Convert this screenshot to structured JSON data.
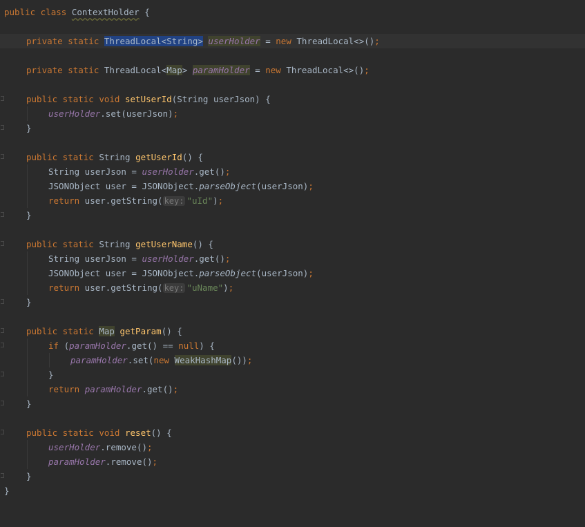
{
  "code": {
    "class_decl": {
      "kw": "public class",
      "name": "ContextHolder",
      "brace": "{"
    },
    "user_holder": {
      "mods": "private static",
      "type": "ThreadLocal<String>",
      "name": "userHolder",
      "assign": "=",
      "kw_new": "new",
      "init": "ThreadLocal<>()",
      "semi": ";"
    },
    "param_holder": {
      "mods": "private static",
      "type_a": "ThreadLocal<",
      "type_b": "Map",
      "type_c": ">",
      "name": "paramHolder",
      "assign": "=",
      "kw_new": "new",
      "init": "ThreadLocal<>()",
      "semi": ";"
    },
    "set_user": {
      "mods": "public static void",
      "name": "setUserId",
      "params": "(String userJson) {",
      "body_field": "userHolder",
      "body_call": ".set(userJson)",
      "semi": ";",
      "close": "}"
    },
    "get_user_id": {
      "mods": "public static",
      "ret": "String",
      "name": "getUserId",
      "params": "() {",
      "l1a": "String userJson = ",
      "l1_field": "userHolder",
      "l1b": ".get()",
      "semi": ";",
      "l2a": "JSONObject user = JSONObject.",
      "l2_call": "parseObject",
      "l2b": "(userJson)",
      "l3_kw": "return",
      "l3a": " user.getString(",
      "l3_hint": "key:",
      "l3_str": "\"uId\"",
      "l3b": ")",
      "close": "}"
    },
    "get_user_name": {
      "mods": "public static",
      "ret": "String",
      "name": "getUserName",
      "params": "() {",
      "l1a": "String userJson = ",
      "l1_field": "userHolder",
      "l1b": ".get()",
      "semi": ";",
      "l2a": "JSONObject user = JSONObject.",
      "l2_call": "parseObject",
      "l2b": "(userJson)",
      "l3_kw": "return",
      "l3a": " user.getString(",
      "l3_hint": "key:",
      "l3_str": "\"uName\"",
      "l3b": ")",
      "close": "}"
    },
    "get_param": {
      "mods": "public static",
      "ret": "Map",
      "name": "getParam",
      "params": "() {",
      "if_kw": "if",
      "if_a": " (",
      "if_field": "paramHolder",
      "if_b": ".get() == ",
      "if_null": "null",
      "if_c": ") {",
      "set_field": "paramHolder",
      "set_a": ".set(",
      "set_new": "new",
      "set_type": "WeakHashMap",
      "set_b": "())",
      "semi": ";",
      "inner_close": "}",
      "ret_kw": "return",
      "ret_field": "paramHolder",
      "ret_b": ".get()",
      "close": "}"
    },
    "reset": {
      "mods": "public static void",
      "name": "reset",
      "params": "() {",
      "l1_field": "userHolder",
      "l1b": ".remove()",
      "l2_field": "paramHolder",
      "l2b": ".remove()",
      "semi": ";",
      "close": "}"
    },
    "class_close": "}"
  }
}
